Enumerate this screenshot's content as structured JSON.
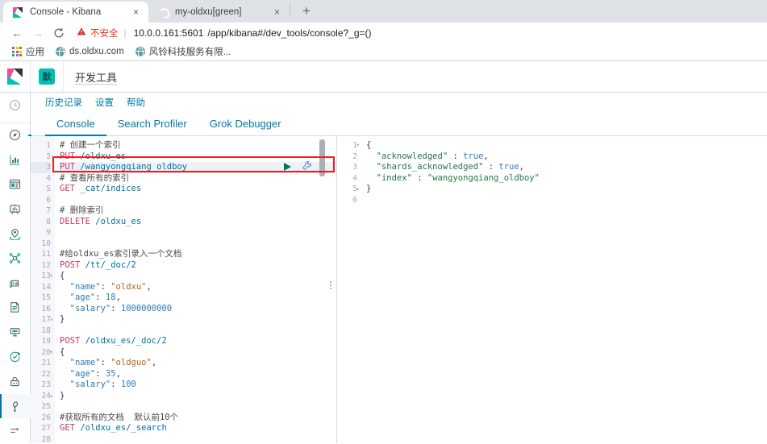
{
  "browser": {
    "tabs": [
      {
        "title": "Console - Kibana",
        "favicon": "kibana-icon",
        "active": true,
        "close_label": "×"
      },
      {
        "title": "my-oldxu[green]",
        "favicon": "elasticsearch-icon",
        "active": false,
        "close_label": "×"
      }
    ],
    "new_tab_label": "+",
    "nav": {
      "back": "←",
      "forward": "→",
      "reload": "⟳"
    },
    "omnibox": {
      "security_icon": "warning-triangle-icon",
      "security_label": "不安全",
      "separator": "|",
      "url_host": "10.0.0.161:5601",
      "url_path": "/app/kibana#/dev_tools/console?_g=()"
    },
    "bookmarks": [
      {
        "label": "应用",
        "icon": "apps-grid-icon"
      },
      {
        "label": "ds.oldxu.com",
        "icon": "globe-icon"
      },
      {
        "label": "风铃科技服务有限...",
        "icon": "globe-icon"
      }
    ]
  },
  "kibana": {
    "logo": "kibana-logo-icon",
    "space_badge": "默",
    "breadcrumb": "开发工具",
    "sidebar": {
      "top_item": {
        "name": "recently-viewed",
        "icon": "clock-icon"
      },
      "items": [
        {
          "name": "discover",
          "icon": "compass-icon",
          "selected": false,
          "active_mark": true
        },
        {
          "name": "visualize",
          "icon": "bar-chart-icon",
          "selected": false
        },
        {
          "name": "dashboard",
          "icon": "dashboard-icon",
          "selected": false
        },
        {
          "name": "canvas",
          "icon": "presentation-icon",
          "selected": false
        },
        {
          "name": "maps",
          "icon": "map-marker-icon",
          "selected": false
        },
        {
          "name": "machine-learning",
          "icon": "network-icon",
          "selected": false
        },
        {
          "name": "infrastructure",
          "icon": "infrastructure-icon",
          "selected": false
        },
        {
          "name": "logs",
          "icon": "logs-icon",
          "selected": false
        },
        {
          "name": "apm",
          "icon": "apm-icon",
          "selected": false
        },
        {
          "name": "uptime",
          "icon": "uptime-icon",
          "selected": false
        },
        {
          "name": "siem",
          "icon": "lock-icon",
          "selected": false
        },
        {
          "name": "dev-tools",
          "icon": "wrench-icon",
          "selected": true
        },
        {
          "name": "management",
          "icon": "management-icon",
          "selected": false
        }
      ]
    },
    "subnav": [
      {
        "label": "历史记录",
        "name": "history-link"
      },
      {
        "label": "设置",
        "name": "settings-link"
      },
      {
        "label": "帮助",
        "name": "help-link"
      }
    ],
    "tabs": [
      {
        "label": "Console",
        "active": true
      },
      {
        "label": "Search Profiler",
        "active": false
      },
      {
        "label": "Grok Debugger",
        "active": false
      }
    ],
    "console": {
      "editor": {
        "highlighted_line": 3,
        "cursor_line": 3,
        "actions": {
          "play": "play-icon",
          "wrench": "wrench-icon"
        },
        "lines": [
          {
            "n": 1,
            "fold": "",
            "tokens": [
              {
                "t": "# 创建一个索引",
                "c": "cm"
              }
            ]
          },
          {
            "n": 2,
            "fold": "",
            "tokens": [
              {
                "t": "PUT",
                "c": "m"
              },
              {
                "t": " ",
                "c": "p"
              },
              {
                "t": "/oldxu_es",
                "c": "u"
              }
            ]
          },
          {
            "n": 3,
            "fold": "",
            "tokens": [
              {
                "t": "PUT",
                "c": "m"
              },
              {
                "t": " ",
                "c": "p"
              },
              {
                "t": "/wangyongqiang_oldboy",
                "c": "u"
              }
            ]
          },
          {
            "n": 4,
            "fold": "",
            "tokens": [
              {
                "t": "# 查看所有的索引",
                "c": "cm"
              }
            ]
          },
          {
            "n": 5,
            "fold": "",
            "tokens": [
              {
                "t": "GET",
                "c": "m"
              },
              {
                "t": " ",
                "c": "p"
              },
              {
                "t": "_cat/indices",
                "c": "u"
              }
            ]
          },
          {
            "n": 6,
            "fold": "",
            "tokens": []
          },
          {
            "n": 7,
            "fold": "",
            "tokens": [
              {
                "t": "# 删除索引",
                "c": "cm"
              }
            ]
          },
          {
            "n": 8,
            "fold": "",
            "tokens": [
              {
                "t": "DELETE",
                "c": "m"
              },
              {
                "t": " ",
                "c": "p"
              },
              {
                "t": "/oldxu_es",
                "c": "u"
              }
            ]
          },
          {
            "n": 9,
            "fold": "",
            "tokens": []
          },
          {
            "n": 10,
            "fold": "",
            "tokens": []
          },
          {
            "n": 11,
            "fold": "",
            "tokens": [
              {
                "t": "#给oldxu_es索引录入一个文档",
                "c": "cm"
              }
            ]
          },
          {
            "n": 12,
            "fold": "",
            "tokens": [
              {
                "t": "POST",
                "c": "m"
              },
              {
                "t": " ",
                "c": "p"
              },
              {
                "t": "/tt/_doc/2",
                "c": "u"
              }
            ]
          },
          {
            "n": 13,
            "fold": "▾",
            "tokens": [
              {
                "t": "{",
                "c": "p"
              }
            ]
          },
          {
            "n": 14,
            "fold": "",
            "tokens": [
              {
                "t": "  \"name\"",
                "c": "k"
              },
              {
                "t": ": ",
                "c": "p"
              },
              {
                "t": "\"oldxu\"",
                "c": "s"
              },
              {
                "t": ",",
                "c": "p"
              }
            ]
          },
          {
            "n": 15,
            "fold": "",
            "tokens": [
              {
                "t": "  \"age\"",
                "c": "k"
              },
              {
                "t": ": ",
                "c": "p"
              },
              {
                "t": "18",
                "c": "n"
              },
              {
                "t": ",",
                "c": "p"
              }
            ]
          },
          {
            "n": 16,
            "fold": "",
            "tokens": [
              {
                "t": "  \"salary\"",
                "c": "k"
              },
              {
                "t": ": ",
                "c": "p"
              },
              {
                "t": "1000000000",
                "c": "n"
              }
            ]
          },
          {
            "n": 17,
            "fold": "▴",
            "tokens": [
              {
                "t": "}",
                "c": "p"
              }
            ]
          },
          {
            "n": 18,
            "fold": "",
            "tokens": []
          },
          {
            "n": 19,
            "fold": "",
            "tokens": [
              {
                "t": "POST",
                "c": "m"
              },
              {
                "t": " ",
                "c": "p"
              },
              {
                "t": "/oldxu_es/_doc/2",
                "c": "u"
              }
            ]
          },
          {
            "n": 20,
            "fold": "▾",
            "tokens": [
              {
                "t": "{",
                "c": "p"
              }
            ]
          },
          {
            "n": 21,
            "fold": "",
            "tokens": [
              {
                "t": "  \"name\"",
                "c": "k"
              },
              {
                "t": ": ",
                "c": "p"
              },
              {
                "t": "\"oldguo\"",
                "c": "s"
              },
              {
                "t": ",",
                "c": "p"
              }
            ]
          },
          {
            "n": 22,
            "fold": "",
            "tokens": [
              {
                "t": "  \"age\"",
                "c": "k"
              },
              {
                "t": ": ",
                "c": "p"
              },
              {
                "t": "35",
                "c": "n"
              },
              {
                "t": ",",
                "c": "p"
              }
            ]
          },
          {
            "n": 23,
            "fold": "",
            "tokens": [
              {
                "t": "  \"salary\"",
                "c": "k"
              },
              {
                "t": ": ",
                "c": "p"
              },
              {
                "t": "100",
                "c": "n"
              }
            ]
          },
          {
            "n": 24,
            "fold": "▴",
            "tokens": [
              {
                "t": "}",
                "c": "p"
              }
            ]
          },
          {
            "n": 25,
            "fold": "",
            "tokens": []
          },
          {
            "n": 26,
            "fold": "",
            "tokens": [
              {
                "t": "#获取所有的文档  默认前10个",
                "c": "cm"
              }
            ]
          },
          {
            "n": 27,
            "fold": "",
            "tokens": [
              {
                "t": "GET",
                "c": "m"
              },
              {
                "t": " ",
                "c": "p"
              },
              {
                "t": "/oldxu_es/_search",
                "c": "u"
              }
            ]
          },
          {
            "n": 28,
            "fold": "",
            "tokens": []
          }
        ]
      },
      "response": {
        "lines": [
          {
            "n": 1,
            "fold": "▾",
            "tokens": [
              {
                "t": "{",
                "c": "p"
              }
            ]
          },
          {
            "n": 2,
            "fold": "",
            "tokens": [
              {
                "t": "  \"acknowledged\"",
                "c": "rk"
              },
              {
                "t": " : ",
                "c": "p"
              },
              {
                "t": "true",
                "c": "rb"
              },
              {
                "t": ",",
                "c": "p"
              }
            ]
          },
          {
            "n": 3,
            "fold": "",
            "tokens": [
              {
                "t": "  \"shards_acknowledged\"",
                "c": "rk"
              },
              {
                "t": " : ",
                "c": "p"
              },
              {
                "t": "true",
                "c": "rb"
              },
              {
                "t": ",",
                "c": "p"
              }
            ]
          },
          {
            "n": 4,
            "fold": "",
            "tokens": [
              {
                "t": "  \"index\"",
                "c": "rk"
              },
              {
                "t": " : ",
                "c": "p"
              },
              {
                "t": "\"wangyongqiang_oldboy\"",
                "c": "rs"
              }
            ]
          },
          {
            "n": 5,
            "fold": "▴",
            "tokens": [
              {
                "t": "}",
                "c": "p"
              }
            ]
          },
          {
            "n": 6,
            "fold": "",
            "tokens": []
          }
        ]
      }
    }
  },
  "colors": {
    "kibana_accent": "#0079a5",
    "kibana_teal": "#00bfb3",
    "kibana_pink": "#f04e98",
    "annotation_red": "#f01c1c",
    "play_green": "#00785a",
    "insecure_red": "#d93025"
  }
}
